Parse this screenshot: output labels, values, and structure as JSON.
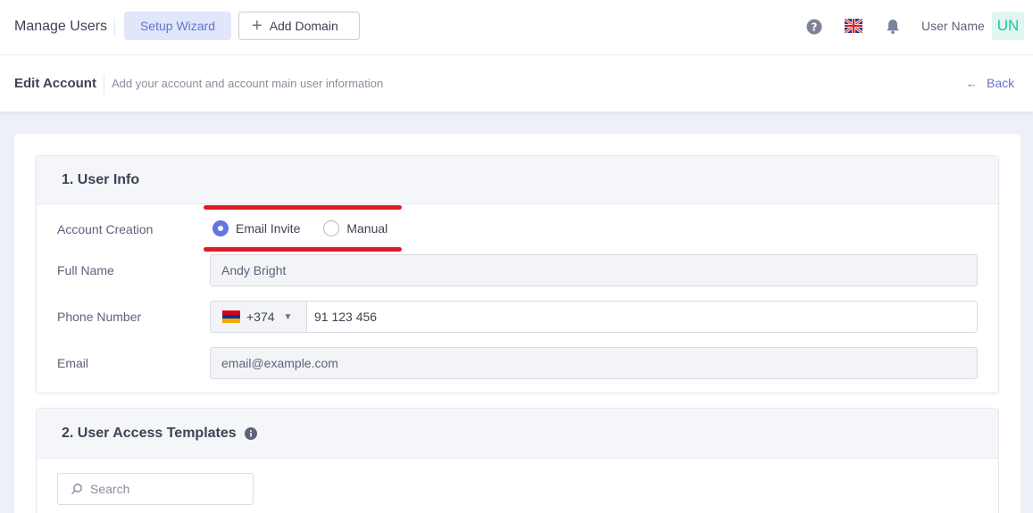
{
  "header": {
    "title": "Manage Users",
    "setup_wizard_label": "Setup Wizard",
    "add_domain_label": "Add Domain",
    "user_name": "User Name",
    "avatar_initials": "UN",
    "icons": [
      "help-icon",
      "uk-flag-icon",
      "bell-icon"
    ]
  },
  "subheader": {
    "title": "Edit Account",
    "description": "Add your account and account main user information",
    "back_label": "Back"
  },
  "user_info": {
    "title": "1. User Info",
    "account_creation_label": "Account Creation",
    "options": [
      {
        "label": "Email Invite",
        "selected": true
      },
      {
        "label": "Manual",
        "selected": false
      }
    ],
    "full_name_label": "Full Name",
    "full_name_value": "Andy Bright",
    "phone_label": "Phone Number",
    "phone_country_code": "+374",
    "phone_value": "91 123 456",
    "email_label": "Email",
    "email_placeholder": "email@example.com"
  },
  "access_templates": {
    "title": "2. User Access Templates",
    "search_placeholder": "Search"
  },
  "colors": {
    "accent": "#6574e6",
    "annotation_red": "#e11b22",
    "avatar_bg": "#dff7ef",
    "avatar_text": "#1bc5a0"
  }
}
